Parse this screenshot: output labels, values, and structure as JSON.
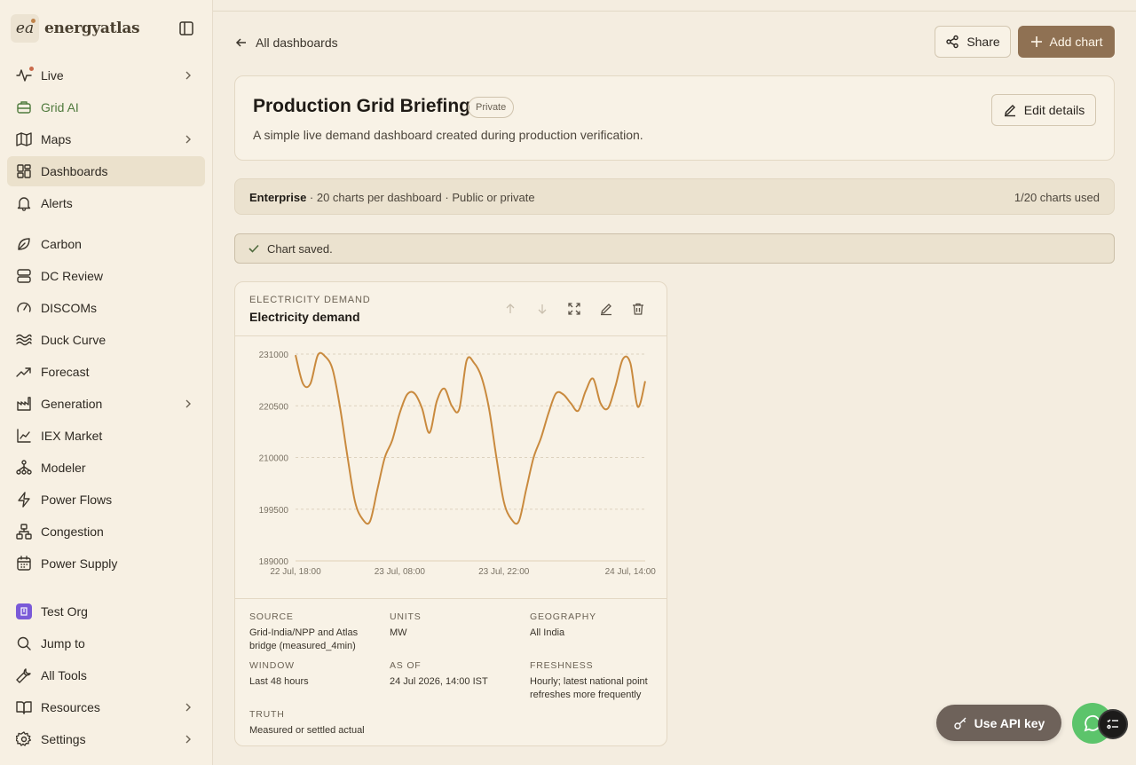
{
  "app": {
    "logo_mark": "ea",
    "name": "energyatlas"
  },
  "sidebar": {
    "items": [
      {
        "label": "Live",
        "icon": "activity-icon",
        "chevron": true
      },
      {
        "label": "Grid AI",
        "icon": "briefcase-icon"
      },
      {
        "label": "Maps",
        "icon": "map-icon",
        "chevron": true
      },
      {
        "label": "Dashboards",
        "icon": "dashboard-icon",
        "active": true
      },
      {
        "label": "Alerts",
        "icon": "bell-icon"
      },
      {
        "label": "Carbon",
        "icon": "leaf-icon"
      },
      {
        "label": "DC Review",
        "icon": "server-icon"
      },
      {
        "label": "DISCOMs",
        "icon": "gauge-icon"
      },
      {
        "label": "Duck Curve",
        "icon": "waves-icon"
      },
      {
        "label": "Forecast",
        "icon": "trending-up-icon"
      },
      {
        "label": "Generation",
        "icon": "factory-icon",
        "chevron": true
      },
      {
        "label": "IEX Market",
        "icon": "line-chart-icon"
      },
      {
        "label": "Modeler",
        "icon": "network-icon"
      },
      {
        "label": "Power Flows",
        "icon": "zap-icon"
      },
      {
        "label": "Congestion",
        "icon": "hierarchy-icon"
      },
      {
        "label": "Power Supply",
        "icon": "calendar-grid-icon"
      },
      {
        "label": "Test Org",
        "icon": "org-icon"
      },
      {
        "label": "Jump to",
        "icon": "search-icon"
      },
      {
        "label": "All Tools",
        "icon": "wrench-icon"
      },
      {
        "label": "Resources",
        "icon": "book-icon",
        "chevron": true
      },
      {
        "label": "Settings",
        "icon": "gear-icon",
        "chevron": true
      }
    ]
  },
  "header": {
    "back_label": "All dashboards",
    "share_label": "Share",
    "add_chart_label": "Add chart"
  },
  "dashboard": {
    "title": "Production Grid Briefing",
    "visibility": "Private",
    "description": "A simple live demand dashboard created during production verification.",
    "edit_label": "Edit details"
  },
  "plan": {
    "tier": "Enterprise",
    "details": " · 20 charts per dashboard · Public or private",
    "usage": "1/20 charts used"
  },
  "notice": {
    "text": "Chart saved."
  },
  "chart_card": {
    "eyebrow": "ELECTRICITY DEMAND",
    "title": "Electricity demand",
    "meta": {
      "source_label": "SOURCE",
      "source": "Grid-India/NPP and Atlas bridge (measured_4min)",
      "units_label": "UNITS",
      "units": "MW",
      "geography_label": "GEOGRAPHY",
      "geography": "All India",
      "window_label": "WINDOW",
      "window": "Last 48 hours",
      "as_of_label": "AS OF",
      "as_of": "24 Jul 2026, 14:00 IST",
      "freshness_label": "FRESHNESS",
      "freshness": "Hourly; latest national point refreshes more frequently",
      "truth_label": "TRUTH",
      "truth": "Measured or settled actual"
    }
  },
  "chart_data": {
    "type": "line",
    "series": [
      {
        "color": "#c98a3e",
        "x": [
          0,
          1,
          2,
          3,
          4,
          5,
          6,
          7,
          8,
          9,
          10,
          11,
          12,
          13,
          14,
          15,
          16,
          17,
          18,
          19,
          20,
          21,
          22,
          23,
          24,
          25,
          26,
          27,
          28,
          29,
          30,
          31,
          32,
          33,
          34,
          35,
          36,
          37,
          38,
          39,
          40,
          41,
          42,
          43,
          44,
          45,
          46,
          47
        ],
        "values": [
          230800,
          225000,
          225000,
          230800,
          230500,
          227800,
          220000,
          210000,
          201000,
          197500,
          197000,
          203500,
          210000,
          213500,
          219000,
          222800,
          223000,
          220000,
          215000,
          221500,
          224000,
          220500,
          219800,
          229700,
          229200,
          226300,
          220000,
          210000,
          201000,
          197500,
          197000,
          203500,
          210000,
          214000,
          219000,
          223000,
          222800,
          221000,
          219500,
          223500,
          226000,
          221000,
          220000,
          224500,
          230000,
          229200,
          220300,
          225500
        ]
      }
    ],
    "x_ticks": [
      "22 Jul, 18:00",
      "23 Jul, 08:00",
      "23 Jul, 22:00",
      "24 Jul, 14:00"
    ],
    "x_tick_index": [
      0,
      14,
      28,
      45
    ],
    "y_ticks": [
      189000,
      199500,
      210000,
      220500,
      231000
    ],
    "ylim": [
      189000,
      231000
    ],
    "grid": true
  },
  "floating": {
    "api_label": "Use API key"
  }
}
